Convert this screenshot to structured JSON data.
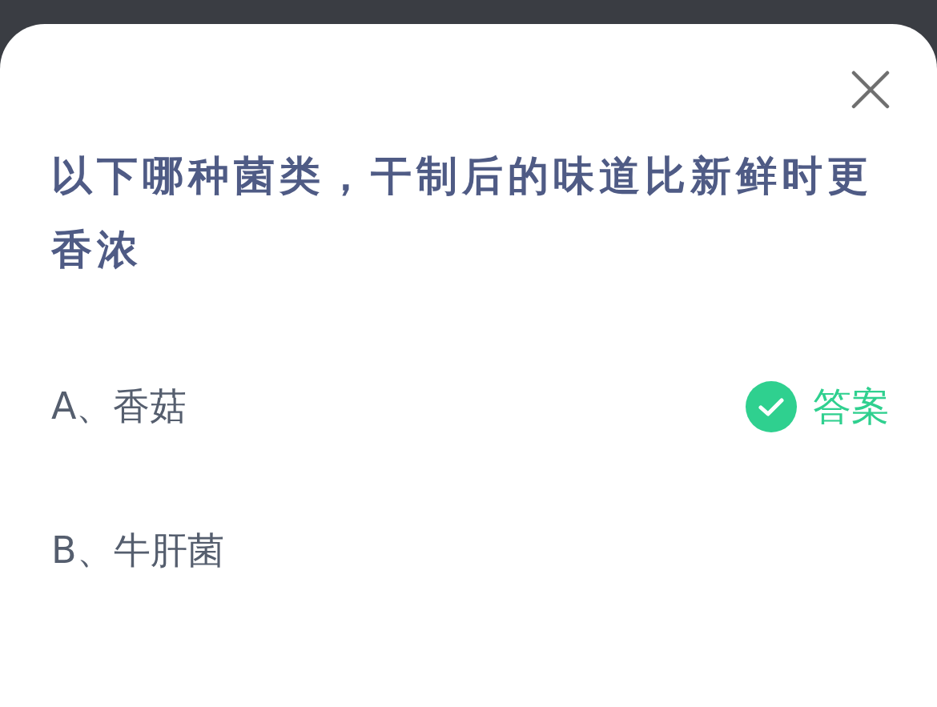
{
  "question": "以下哪种菌类，干制后的味道比新鲜时更香浓",
  "options": [
    {
      "label": "A、香菇",
      "correct": true,
      "answer_label": "答案"
    },
    {
      "label": "B、牛肝菌",
      "correct": false
    }
  ]
}
